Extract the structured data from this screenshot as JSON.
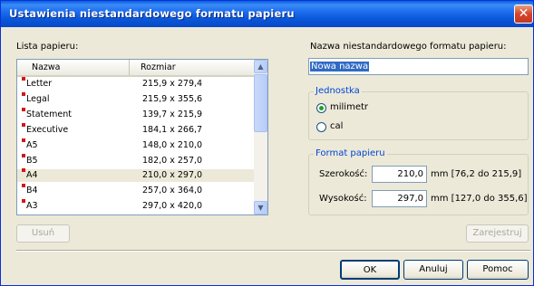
{
  "window": {
    "title": "Ustawienia niestandardowego formatu papieru",
    "close_glyph": "✕"
  },
  "paper_list": {
    "label": "Lista papieru:",
    "columns": [
      "Nazwa",
      "Rozmiar"
    ],
    "rows": [
      {
        "name": "Letter",
        "size": "215,9 x 279,4"
      },
      {
        "name": "Legal",
        "size": "215,9 x 355,6"
      },
      {
        "name": "Statement",
        "size": "139,7 x 215,9"
      },
      {
        "name": "Executive",
        "size": "184,1 x 266,7"
      },
      {
        "name": "A5",
        "size": "148,0 x 210,0"
      },
      {
        "name": "B5",
        "size": "182,0 x 257,0"
      },
      {
        "name": "A4",
        "size": "210,0 x 297,0"
      },
      {
        "name": "B4",
        "size": "257,0 x 364,0"
      },
      {
        "name": "A3",
        "size": "297,0 x 420,0"
      }
    ],
    "selected_index": 6
  },
  "delete_button": "Usuń",
  "name_field": {
    "label": "Nazwa niestandardowego formatu papieru:",
    "value": "Nowa nazwa"
  },
  "units": {
    "legend": "Jednostka",
    "options": [
      "milimetr",
      "cal"
    ],
    "selected": "milimetr"
  },
  "paper_format": {
    "legend": "Format papieru",
    "width_label": "Szerokość:",
    "width_value": "210,0",
    "width_range": "mm [76,2 do 215,9]",
    "height_label": "Wysokość:",
    "height_value": "297,0",
    "height_range": "mm [127,0 do 355,6]"
  },
  "save_button": "Zarejestruj",
  "footer": {
    "ok": "OK",
    "cancel": "Anuluj",
    "help": "Pomoc"
  }
}
